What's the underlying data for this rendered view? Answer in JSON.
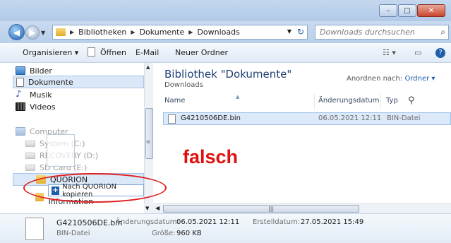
{
  "window": {
    "minimize": "–",
    "maximize": "□",
    "close": "✕"
  },
  "address": {
    "crumbs": [
      "Bibliotheken",
      "Dokumente",
      "Downloads"
    ],
    "search_placeholder": "Downloads durchsuchen"
  },
  "toolbar": {
    "organize": "Organisieren ▾",
    "open": "Öffnen",
    "email": "E-Mail",
    "new_folder": "Neuer Ordner"
  },
  "nav": {
    "items": [
      {
        "label": "Bilder",
        "icon": "pictures-icon"
      },
      {
        "label": "Dokumente",
        "icon": "documents-icon",
        "selected": true
      },
      {
        "label": "Musik",
        "icon": "music-icon"
      },
      {
        "label": "Videos",
        "icon": "videos-icon"
      },
      {
        "label": "Computer",
        "icon": "computer-icon"
      },
      {
        "label": "System (C:)",
        "icon": "drive-icon"
      },
      {
        "label": "RECOVERY (D:)",
        "icon": "drive-icon"
      },
      {
        "label": "SD Card (E:)",
        "icon": "drive-icon"
      },
      {
        "label": "QUORION",
        "icon": "folder-icon"
      },
      {
        "label": "System Volume Information",
        "icon": "folder-icon"
      }
    ]
  },
  "content": {
    "library_title": "Bibliothek \"Dokumente\"",
    "library_sub": "Downloads",
    "arrange_label": "Anordnen nach:",
    "arrange_value": "Ordner ▾",
    "columns": {
      "name": "Name",
      "date": "Änderungsdatum",
      "type": "Typ"
    },
    "files": [
      {
        "name": "G4210506DE.bin",
        "date": "06.05.2021 12:11",
        "type": "BIN-Datei"
      }
    ],
    "annotation": "falsch"
  },
  "drag": {
    "tooltip": "Nach QUORION kopieren"
  },
  "details": {
    "filename": "G4210506DE.bin",
    "modified_label": "Änderungsdatum:",
    "modified": "06.05.2021 12:11",
    "created_label": "Erstelldatum:",
    "created": "27.05.2021 15:49",
    "type": "BIN-Datei",
    "size_label": "Größe:",
    "size": "960 KB"
  },
  "colors": {
    "annotation_red": "#e01010",
    "selection_blue": "#dce9f8"
  }
}
